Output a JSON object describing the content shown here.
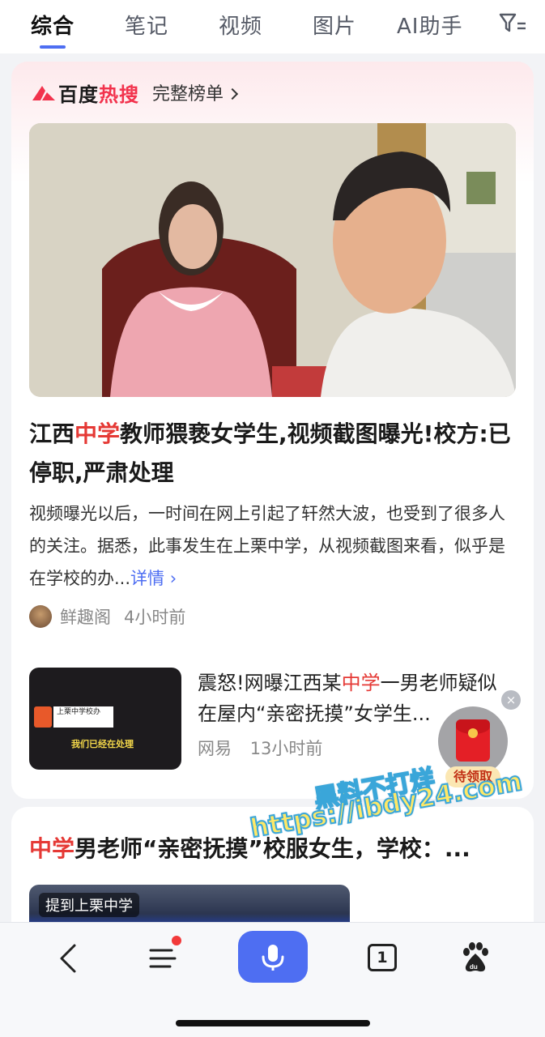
{
  "tabs": {
    "items": [
      {
        "label": "综合",
        "active": true
      },
      {
        "label": "笔记",
        "active": false
      },
      {
        "label": "视频",
        "active": false
      },
      {
        "label": "图片",
        "active": false
      },
      {
        "label": "AI助手",
        "active": false
      }
    ],
    "filter_icon": "filter-icon"
  },
  "hot": {
    "brand_prefix": "百度",
    "brand_hot": "热搜",
    "full_list_label": "完整榜单"
  },
  "article1": {
    "title_pre": "江西",
    "title_hl": "中学",
    "title_post": "教师猥亵女学生,视频截图曝光!校方:已停职,严肃处理",
    "summary": "视频曝光以后，一时间在网上引起了轩然大波，也受到了很多人的关注。据悉，此事发生在上栗中学，从视频截图来看，似乎是在学校的办...",
    "more_label": "详情",
    "source": "鲜趣阁",
    "time": "4小时前"
  },
  "article2": {
    "title_pre": "震怒!网曝江西某",
    "title_hl": "中学",
    "title_post": "一男老师疑似在屋内“亲密抚摸”女学生...",
    "source": "网易",
    "time": "13小时前",
    "thumb_badge": "上栗中学校办",
    "thumb_caption": "我们已经在处理"
  },
  "red_packet": {
    "label": "待领取",
    "close": "×"
  },
  "watermark": {
    "line1": "黑料不打烊",
    "line2": "https://ibdy24.com"
  },
  "article3": {
    "title_hl": "中学",
    "title_post": "男老师“亲密抚摸”校服女生，学校：...",
    "tag": "提到上栗中学"
  },
  "bottom_bar": {
    "tabs_count": "1"
  },
  "colors": {
    "accent": "#4e6ef2",
    "highlight_red": "#e53935",
    "hot_red": "#f2334d"
  }
}
